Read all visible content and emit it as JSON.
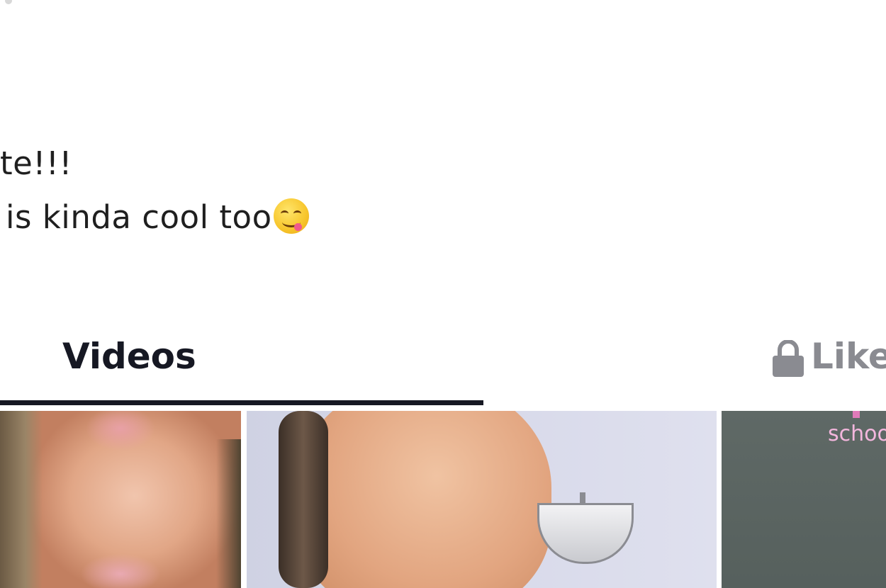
{
  "profile": {
    "bio_line_1": "te!!!",
    "bio_line_2": "is kinda cool too",
    "bio_emoji": "face-savoring-food-emoji"
  },
  "tabs": {
    "videos_label": "Videos",
    "liked_label": "Like",
    "active": "Videos"
  },
  "grid": {
    "thumbnails": [
      {
        "overlay_text": ""
      },
      {
        "overlay_text": ""
      },
      {
        "overlay_text": "schoo"
      }
    ]
  },
  "colors": {
    "text_primary": "#161823",
    "text_secondary": "#8a8b91",
    "overlay_pink": "#f3b6dd"
  }
}
